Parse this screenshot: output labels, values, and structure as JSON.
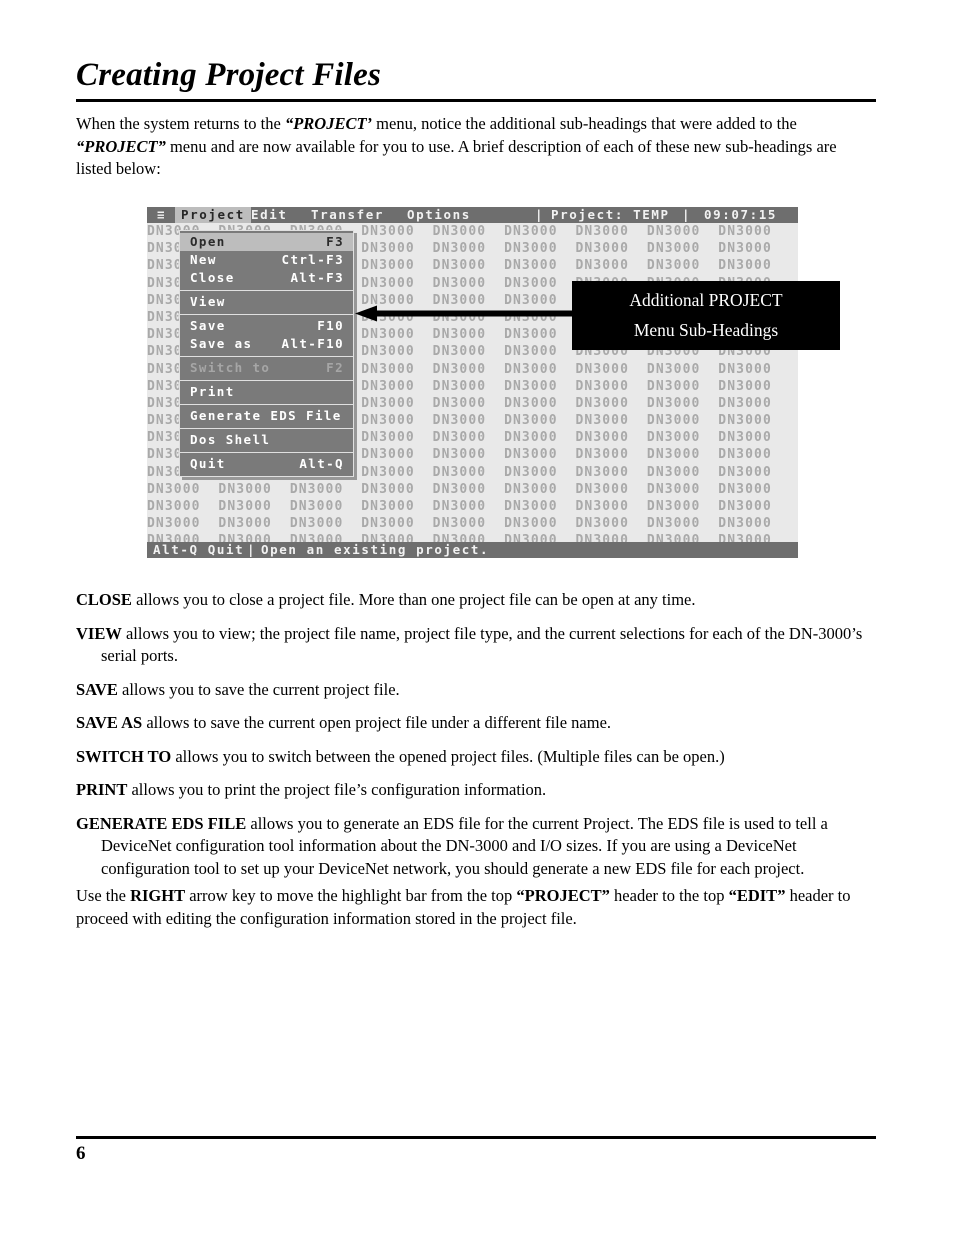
{
  "page": {
    "title": "Creating Project Files",
    "number": "6"
  },
  "intro": {
    "part1": "When the system returns to the ",
    "emph1": "“PROJECT’",
    "part2": " menu, notice the additional sub-headings that were added to the ",
    "emph2": "“PROJECT”",
    "part3": " menu and are now available for you to use.  A brief description of each of these new sub-headings are listed below:"
  },
  "dos_screen": {
    "menubar": {
      "hamburger_icon": "≡",
      "items": [
        "Project",
        "Edit",
        "Transfer",
        "Options"
      ],
      "separator": "|",
      "project_label": "Project: TEMP",
      "clock": "09:07:15"
    },
    "dropdown": {
      "groups": [
        {
          "items": [
            {
              "label": "Open",
              "key": "F3",
              "state": "selected"
            },
            {
              "label": "New",
              "key": "Ctrl-F3",
              "state": "normal"
            },
            {
              "label": "Close",
              "key": "Alt-F3",
              "state": "normal"
            }
          ]
        },
        {
          "items": [
            {
              "label": "View",
              "key": "",
              "state": "normal"
            }
          ]
        },
        {
          "items": [
            {
              "label": "Save",
              "key": "F10",
              "state": "normal"
            },
            {
              "label": "Save as",
              "key": "Alt-F10",
              "state": "normal"
            }
          ]
        },
        {
          "items": [
            {
              "label": "Switch to",
              "key": "F2",
              "state": "disabled"
            }
          ]
        },
        {
          "items": [
            {
              "label": "Print",
              "key": "",
              "state": "normal"
            }
          ]
        },
        {
          "items": [
            {
              "label": "Generate EDS File",
              "key": "",
              "state": "normal"
            }
          ]
        },
        {
          "items": [
            {
              "label": "Dos Shell",
              "key": "",
              "state": "normal"
            }
          ]
        },
        {
          "items": [
            {
              "label": "Quit",
              "key": "Alt-Q",
              "state": "normal"
            }
          ]
        }
      ]
    },
    "wallpaper_token": "DN3000",
    "statusbar": {
      "quit_hint": "Alt-Q Quit",
      "separator": "|",
      "description": "Open an existing project."
    }
  },
  "callout": {
    "line1": "Additional PROJECT",
    "line2": "Menu Sub-Headings",
    "arrow_icon": "left-arrow-icon",
    "background_color": "#000000",
    "text_color": "#ffffff"
  },
  "definitions": [
    {
      "term": "CLOSE",
      "text": " allows you to close a project file.  More than one project file can be open at any time."
    },
    {
      "term": "VIEW",
      "text": " allows you to view;  the project file name,  project file type, and the current selections for each of the DN-3000’s serial ports."
    },
    {
      "term": "SAVE",
      "text": " allows you to save the current project file."
    },
    {
      "term": "SAVE AS",
      "text": " allows to save the current open project file under a different file name."
    },
    {
      "term": "SWITCH TO",
      "text": " allows you to switch between the opened project files.  (Multiple files can be open.)"
    },
    {
      "term": "PRINT",
      "text": " allows you to print the project file’s configuration information."
    },
    {
      "term": "GENERATE EDS FILE",
      "text": " allows you to generate an EDS file for the current Project.  The EDS file is used to tell a DeviceNet configuration tool information about the DN-3000 and I/O sizes.  If you are using a DeviceNet configuration tool to set up your DeviceNet network, you should generate a new EDS file for each project."
    }
  ],
  "closing": {
    "part1": "Use the ",
    "emph1": "RIGHT",
    "part2": " arrow key to move the highlight bar from the top ",
    "emph2": "“PROJECT”",
    "part3": " header to the top ",
    "emph3": "“EDIT”",
    "part4": " header to proceed with editing the configuration information stored in the project file."
  }
}
